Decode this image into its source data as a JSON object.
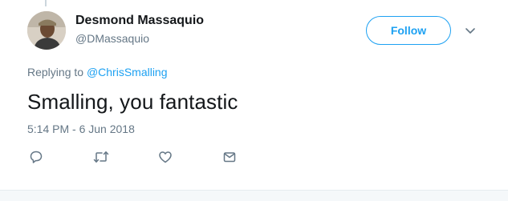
{
  "tweet": {
    "author": {
      "name": "Desmond Massaquio",
      "handle": "@DMassaquio"
    },
    "follow_label": "Follow",
    "replying_prefix": "Replying to",
    "replying_handle": "@ChrisSmalling",
    "text": "Smalling, you fantastic",
    "timestamp": "5:14 PM - 6 Jun 2018"
  },
  "icons": {
    "menu": "chevron-down-icon",
    "reply": "reply-icon",
    "retweet": "retweet-icon",
    "like": "heart-icon",
    "message": "envelope-icon"
  },
  "colors": {
    "accent": "#1da1f2",
    "secondary_text": "#657786",
    "icon": "#657786"
  }
}
